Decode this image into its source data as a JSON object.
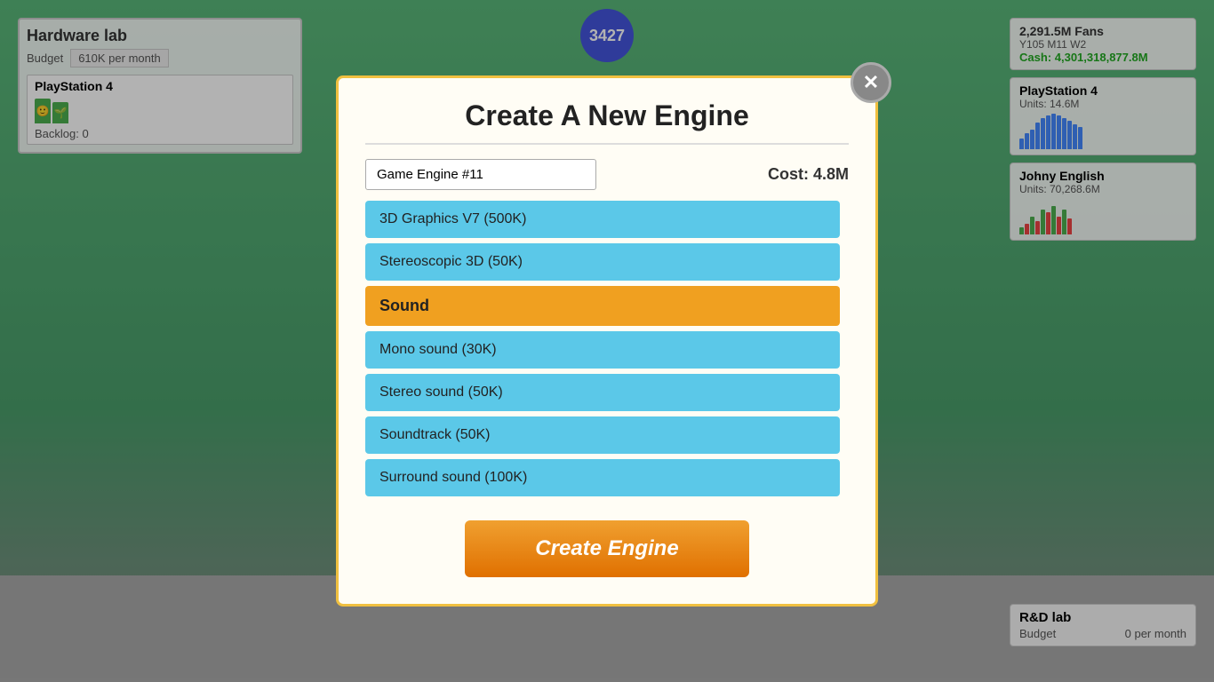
{
  "hardware_lab": {
    "title": "Hardware lab",
    "budget_label": "Budget",
    "budget_value": "610K per month",
    "ps4": {
      "name": "PlayStation 4",
      "backlog": "Backlog: 0"
    }
  },
  "stats": {
    "fans": "2,291.5M Fans",
    "date": "Y105 M11 W2",
    "cash_label": "Cash:",
    "cash_value": "4,301,318,877.8M"
  },
  "ps4_product": {
    "name": "PlayStation 4",
    "units": "Units: 14.6M"
  },
  "johny_english": {
    "name": "Johny English",
    "units": "Units: 70,268.6M"
  },
  "rd_lab": {
    "title": "R&D lab",
    "budget_label": "Budget",
    "budget_value": "0 per month"
  },
  "score_badge": {
    "value": "3427"
  },
  "modal": {
    "title": "Create A New Engine",
    "engine_name": "Game Engine #11",
    "cost_label": "Cost: 4.8M",
    "features": [
      {
        "type": "item",
        "label": "3D Graphics V7 (500K)"
      },
      {
        "type": "item",
        "label": "Stereoscopic 3D (50K)"
      },
      {
        "type": "category",
        "label": "Sound"
      },
      {
        "type": "item",
        "label": "Mono sound (30K)"
      },
      {
        "type": "item",
        "label": "Stereo sound (50K)"
      },
      {
        "type": "item",
        "label": "Soundtrack (50K)"
      },
      {
        "type": "item",
        "label": "Surround sound (100K)"
      }
    ],
    "create_button": "Create Engine"
  }
}
